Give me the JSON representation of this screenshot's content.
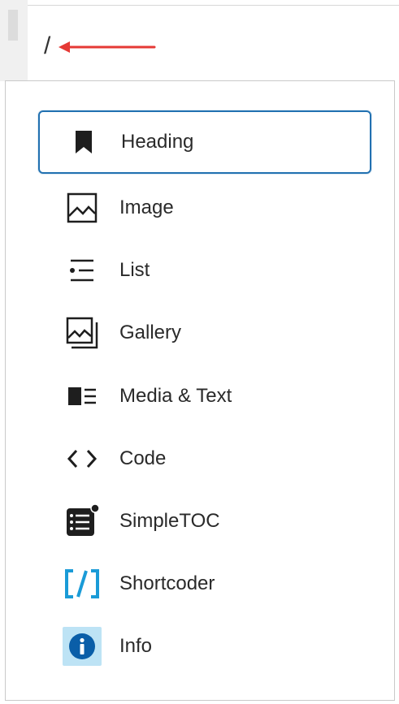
{
  "editor": {
    "typed_text": "/"
  },
  "inserter": {
    "items": [
      {
        "label": "Heading",
        "icon": "bookmark-icon",
        "selected": true
      },
      {
        "label": "Image",
        "icon": "image-icon",
        "selected": false
      },
      {
        "label": "List",
        "icon": "list-icon",
        "selected": false
      },
      {
        "label": "Gallery",
        "icon": "gallery-icon",
        "selected": false
      },
      {
        "label": "Media & Text",
        "icon": "media-text-icon",
        "selected": false
      },
      {
        "label": "Code",
        "icon": "code-icon",
        "selected": false
      },
      {
        "label": "SimpleTOC",
        "icon": "simpletoc-icon",
        "selected": false
      },
      {
        "label": "Shortcoder",
        "icon": "shortcoder-icon",
        "selected": false
      },
      {
        "label": "Info",
        "icon": "info-icon",
        "selected": false
      }
    ]
  },
  "colors": {
    "selection_border": "#2271b1",
    "annotation_arrow": "#e53935",
    "shortcoder_icon": "#1a9bd7",
    "info_icon": "#0a5ea8",
    "info_icon_bg": "#bde3f5"
  }
}
